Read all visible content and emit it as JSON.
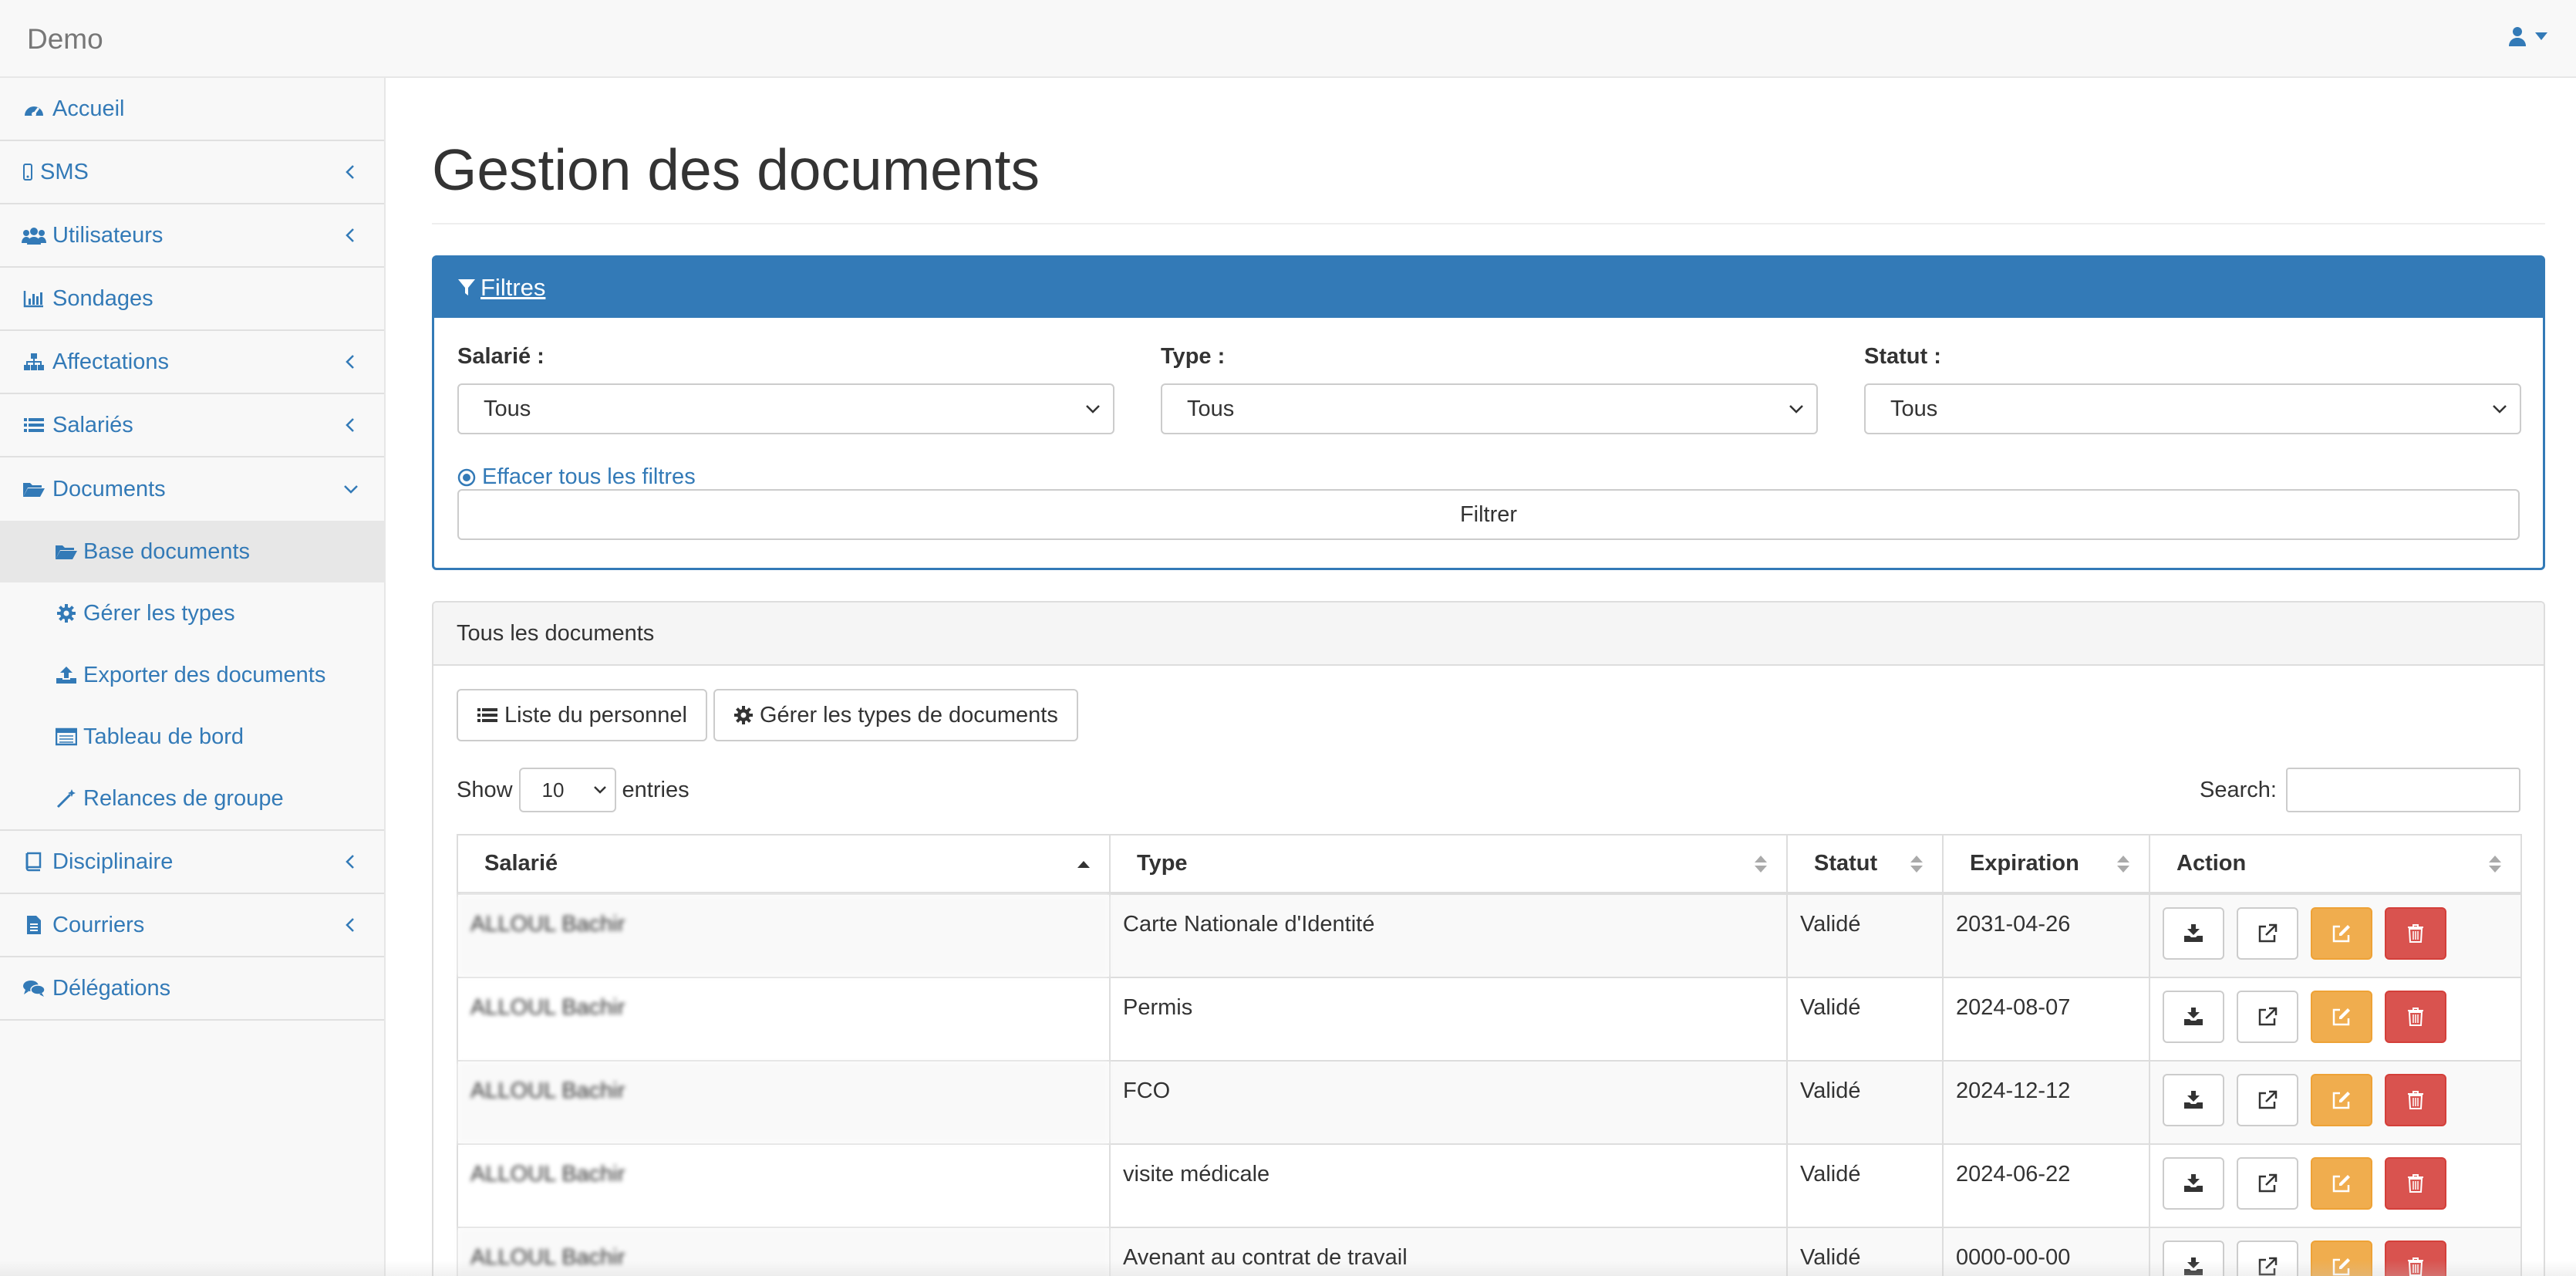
{
  "app": {
    "brand": "Demo"
  },
  "header": {
    "user_icon": "user-icon"
  },
  "sidebar": {
    "items": [
      {
        "label": "Accueil",
        "icon": "dashboard-icon",
        "chevron": false
      },
      {
        "label": "SMS",
        "icon": "mobile-icon",
        "chevron": true
      },
      {
        "label": "Utilisateurs",
        "icon": "users-icon",
        "chevron": true
      },
      {
        "label": "Sondages",
        "icon": "bar-chart-icon",
        "chevron": false
      },
      {
        "label": "Affectations",
        "icon": "sitemap-icon",
        "chevron": true
      },
      {
        "label": "Salariés",
        "icon": "list-icon",
        "chevron": true
      },
      {
        "label": "Documents",
        "icon": "folder-open-icon",
        "chevron": true,
        "expanded": true
      }
    ],
    "sub_items": [
      {
        "label": "Base documents",
        "icon": "folder-open-icon",
        "active": true
      },
      {
        "label": "Gérer les types",
        "icon": "gear-icon"
      },
      {
        "label": "Exporter des documents",
        "icon": "upload-icon"
      },
      {
        "label": "Tableau de bord",
        "icon": "calendar-icon"
      },
      {
        "label": "Relances de groupe",
        "icon": "magic-wand-icon"
      }
    ],
    "items_after": [
      {
        "label": "Disciplinaire",
        "icon": "book-icon",
        "chevron": true
      },
      {
        "label": "Courriers",
        "icon": "file-icon",
        "chevron": true
      },
      {
        "label": "Délégations",
        "icon": "comments-icon",
        "chevron": false
      }
    ]
  },
  "main": {
    "title": "Gestion des documents",
    "filters": {
      "heading": "Filtres",
      "employee_label": "Salarié :",
      "employee_value": "Tous",
      "type_label": "Type :",
      "type_value": "Tous",
      "status_label": "Statut :",
      "status_value": "Tous",
      "clear_label": "Effacer tous les filtres",
      "submit_label": "Filtrer"
    },
    "documents": {
      "heading": "Tous les documents",
      "staff_list_btn": "Liste du personnel",
      "manage_types_btn": "Gérer les types de documents",
      "show_label": "Show",
      "entries_value": "10",
      "entries_label": "entries",
      "search_label": "Search:",
      "columns": [
        "Salarié",
        "Type",
        "Statut",
        "Expiration",
        "Action"
      ],
      "rows": [
        {
          "employee": "ALLOUL Bachir",
          "type": "Carte Nationale d'Identité",
          "status": "Validé",
          "expiration": "2031-04-26"
        },
        {
          "employee": "ALLOUL Bachir",
          "type": "Permis",
          "status": "Validé",
          "expiration": "2024-08-07"
        },
        {
          "employee": "ALLOUL Bachir",
          "type": "FCO",
          "status": "Validé",
          "expiration": "2024-12-12"
        },
        {
          "employee": "ALLOUL Bachir",
          "type": "visite médicale",
          "status": "Validé",
          "expiration": "2024-06-22"
        },
        {
          "employee": "ALLOUL Bachir",
          "type": "Avenant au contrat de travail",
          "status": "Validé",
          "expiration": "0000-00-00"
        }
      ]
    }
  },
  "colors": {
    "primary": "#337ab7",
    "warning": "#f0ad4e",
    "danger": "#d9534f"
  }
}
